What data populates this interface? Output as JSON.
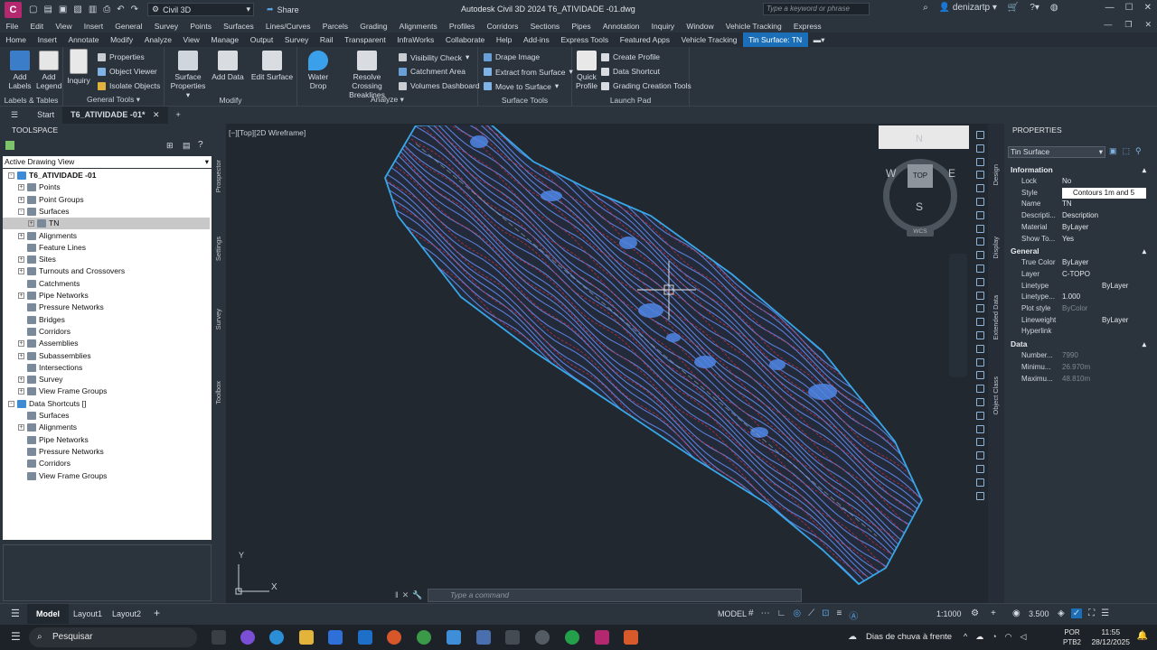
{
  "titlebar": {
    "app_letter": "C",
    "workspace": "Civil 3D",
    "share": "Share",
    "title": "Autodesk Civil 3D 2024   T6_ATIVIDADE -01.dwg",
    "search_placeholder": "Type a keyword or phrase",
    "user": "denizartp"
  },
  "menu": [
    "File",
    "Edit",
    "View",
    "Insert",
    "General",
    "Survey",
    "Points",
    "Surfaces",
    "Lines/Curves",
    "Parcels",
    "Grading",
    "Alignments",
    "Profiles",
    "Corridors",
    "Sections",
    "Pipes",
    "Annotation",
    "Inquiry",
    "Window",
    "Vehicle Tracking",
    "Express"
  ],
  "tabs": [
    "Home",
    "Insert",
    "Annotate",
    "Modify",
    "Analyze",
    "View",
    "Manage",
    "Output",
    "Survey",
    "Rail",
    "Transparent",
    "InfraWorks",
    "Collaborate",
    "Help",
    "Add-ins",
    "Express Tools",
    "Featured Apps",
    "Vehicle Tracking",
    "Tin Surface: TN"
  ],
  "ribbon": {
    "add_labels": "Add Labels",
    "add_legend": "Add Legend",
    "labels_tables": "Labels & Tables",
    "inquiry": "Inquiry",
    "properties": "Properties",
    "object_viewer": "Object Viewer",
    "isolate_objects": "Isolate Objects",
    "general_tools": "General Tools",
    "surface_properties": "Surface Properties",
    "add_data": "Add Data",
    "edit_surface": "Edit Surface",
    "modify": "Modify",
    "water_drop": "Water Drop",
    "resolve_crossing": "Resolve Crossing Breaklines",
    "visibility_check": "Visibility Check",
    "catchment_area": "Catchment Area",
    "volumes_dashboard": "Volumes Dashboard",
    "analyze": "Analyze",
    "drape_image": "Drape Image",
    "extract_from_surface": "Extract from Surface",
    "move_to_surface": "Move to Surface",
    "surface_tools": "Surface Tools",
    "quick_profile": "Quick Profile",
    "create_profile": "Create Profile",
    "data_shortcut": "Data Shortcut",
    "grading_creation_tools": "Grading Creation Tools",
    "launch_pad": "Launch Pad"
  },
  "doctabs": {
    "start": "Start",
    "file": "T6_ATIVIDADE -01*"
  },
  "toolspace": {
    "header": "TOOLSPACE",
    "view": "Active Drawing View",
    "side_tabs": [
      "Prospector",
      "Settings",
      "Survey",
      "Toolbox"
    ],
    "tree": [
      {
        "label": "T6_ATIVIDADE -01",
        "level": 0,
        "exp": "-",
        "bold": true
      },
      {
        "label": "Points",
        "level": 1,
        "exp": "+"
      },
      {
        "label": "Point Groups",
        "level": 1,
        "exp": "+"
      },
      {
        "label": "Surfaces",
        "level": 1,
        "exp": "-"
      },
      {
        "label": "TN",
        "level": 2,
        "exp": "+",
        "selected": true
      },
      {
        "label": "Alignments",
        "level": 1,
        "exp": "+"
      },
      {
        "label": "Feature Lines",
        "level": 1,
        "exp": ""
      },
      {
        "label": "Sites",
        "level": 1,
        "exp": "+"
      },
      {
        "label": "Turnouts and Crossovers",
        "level": 1,
        "exp": "+"
      },
      {
        "label": "Catchments",
        "level": 1,
        "exp": ""
      },
      {
        "label": "Pipe Networks",
        "level": 1,
        "exp": "+"
      },
      {
        "label": "Pressure Networks",
        "level": 1,
        "exp": ""
      },
      {
        "label": "Bridges",
        "level": 1,
        "exp": ""
      },
      {
        "label": "Corridors",
        "level": 1,
        "exp": ""
      },
      {
        "label": "Assemblies",
        "level": 1,
        "exp": "+"
      },
      {
        "label": "Subassemblies",
        "level": 1,
        "exp": "+"
      },
      {
        "label": "Intersections",
        "level": 1,
        "exp": ""
      },
      {
        "label": "Survey",
        "level": 1,
        "exp": "+"
      },
      {
        "label": "View Frame Groups",
        "level": 1,
        "exp": "+"
      },
      {
        "label": "Data Shortcuts []",
        "level": 0,
        "exp": "-"
      },
      {
        "label": "Surfaces",
        "level": 1,
        "exp": ""
      },
      {
        "label": "Alignments",
        "level": 1,
        "exp": "+"
      },
      {
        "label": "Pipe Networks",
        "level": 1,
        "exp": ""
      },
      {
        "label": "Pressure Networks",
        "level": 1,
        "exp": ""
      },
      {
        "label": "Corridors",
        "level": 1,
        "exp": ""
      },
      {
        "label": "View Frame Groups",
        "level": 1,
        "exp": ""
      }
    ]
  },
  "viewport": {
    "label": "[−][Top][2D Wireframe]",
    "viewcube": {
      "top": "TOP",
      "n": "N",
      "s": "S",
      "e": "E",
      "w": "W",
      "wcs": "WCS"
    },
    "ucs_x": "X",
    "ucs_y": "Y"
  },
  "properties": {
    "header": "PROPERTIES",
    "object": "Tin Surface",
    "side_tabs": [
      "Design",
      "Display",
      "Extended Data",
      "Object Class"
    ],
    "sections": [
      {
        "title": "Information",
        "rows": [
          {
            "k": "Lock",
            "v": "No"
          },
          {
            "k": "Style",
            "v": "Contours 1m and 5"
          },
          {
            "k": "Name",
            "v": "TN"
          },
          {
            "k": "Descripti...",
            "v": "Description"
          },
          {
            "k": "Material",
            "v": "ByLayer"
          },
          {
            "k": "Show To...",
            "v": "Yes"
          }
        ]
      },
      {
        "title": "General",
        "rows": [
          {
            "k": "True Color",
            "v": "ByLayer"
          },
          {
            "k": "Layer",
            "v": "C-TOPO"
          },
          {
            "k": "Linetype",
            "v": "ByLayer"
          },
          {
            "k": "Linetype...",
            "v": "1.000"
          },
          {
            "k": "Plot style",
            "v": "ByColor",
            "dim": true
          },
          {
            "k": "Lineweight",
            "v": "ByLayer"
          },
          {
            "k": "Hyperlink",
            "v": ""
          }
        ]
      },
      {
        "title": "Data",
        "rows": [
          {
            "k": "Number...",
            "v": "7990",
            "dim": true
          },
          {
            "k": "Minimu...",
            "v": "26.970m",
            "dim": true
          },
          {
            "k": "Maximu...",
            "v": "48.810m",
            "dim": true
          }
        ]
      }
    ]
  },
  "command": {
    "placeholder": "Type a command"
  },
  "status": {
    "model": "Model",
    "layout1": "Layout1",
    "layout2": "Layout2",
    "model_btn": "MODEL",
    "scale": "1:1000",
    "value": "3.500"
  },
  "taskbar": {
    "search": "Pesquisar",
    "weather": "Dias de chuva à frente",
    "lang": "POR",
    "kbd": "PTB2",
    "time": "11:55",
    "date": "28/12/2025"
  },
  "colors": {
    "accent": "#1b6fb8",
    "contour_blue": "#5b7fd8",
    "contour_red": "#c0283a",
    "boundary": "#37a7e8"
  }
}
